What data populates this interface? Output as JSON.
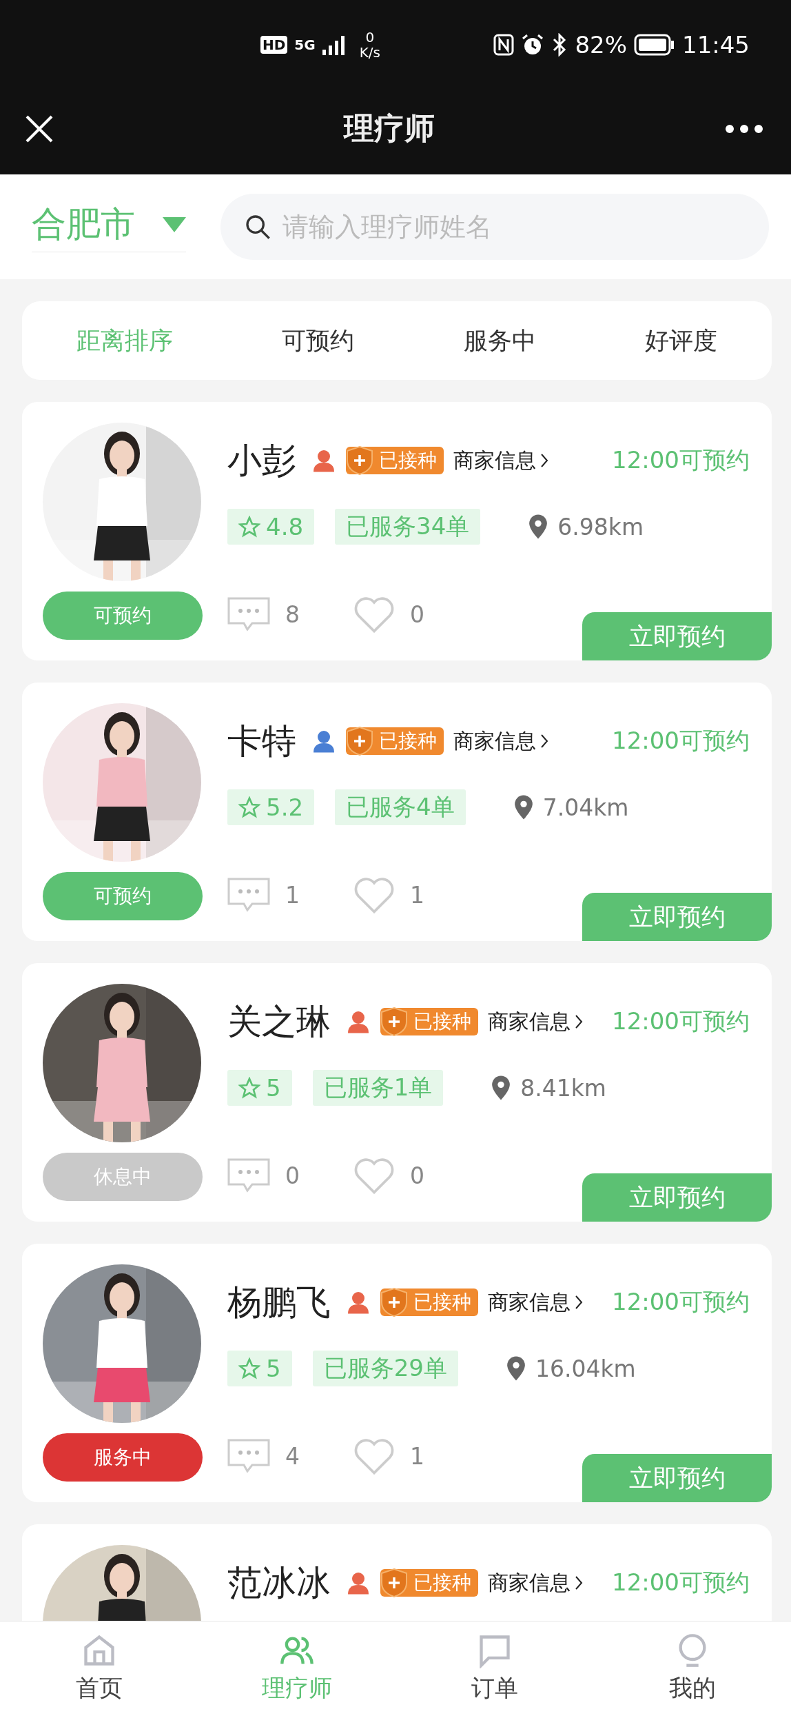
{
  "status_bar": {
    "hd": "HD",
    "network": "5G",
    "speed_value": "0",
    "speed_unit": "K/s",
    "battery": "82%",
    "time": "11:45"
  },
  "header": {
    "title": "理疗师"
  },
  "search": {
    "city": "合肥市",
    "placeholder": "请输入理疗师姓名"
  },
  "sort_tabs": [
    {
      "label": "距离排序",
      "selected": true
    },
    {
      "label": "可预约",
      "selected": false
    },
    {
      "label": "服务中",
      "selected": false
    },
    {
      "label": "好评度",
      "selected": false
    }
  ],
  "therapists": [
    {
      "name": "小彭",
      "color": "#e8654a",
      "badge": "已接种",
      "merchant": "商家信息",
      "availability": "12:00可预约",
      "status": {
        "label": "可预约",
        "color": "#5cc173"
      },
      "rating": "4.8",
      "served": "已服务34单",
      "distance": "6.98km",
      "comments": "8",
      "likes": "0",
      "book": "立即预约"
    },
    {
      "name": "卡特",
      "color": "#4a7fd4",
      "badge": "已接种",
      "merchant": "商家信息",
      "availability": "12:00可预约",
      "status": {
        "label": "可预约",
        "color": "#5cc173"
      },
      "rating": "5.2",
      "served": "已服务4单",
      "distance": "7.04km",
      "comments": "1",
      "likes": "1",
      "book": "立即预约"
    },
    {
      "name": "关之琳",
      "color": "#e8654a",
      "badge": "已接种",
      "merchant": "商家信息",
      "availability": "12:00可预约",
      "status": {
        "label": "休息中",
        "color": "#c9c9c9"
      },
      "rating": "5",
      "served": "已服务1单",
      "distance": "8.41km",
      "comments": "0",
      "likes": "0",
      "book": "立即预约"
    },
    {
      "name": "杨鹏飞",
      "color": "#e8654a",
      "badge": "已接种",
      "merchant": "商家信息",
      "availability": "12:00可预约",
      "status": {
        "label": "服务中",
        "color": "#dc3535"
      },
      "rating": "5",
      "served": "已服务29单",
      "distance": "16.04km",
      "comments": "4",
      "likes": "1",
      "book": "立即预约"
    },
    {
      "name": "范冰冰",
      "color": "#e8654a",
      "badge": "已接种",
      "merchant": "商家信息",
      "availability": "12:00可预约"
    }
  ],
  "bottom_nav": [
    {
      "label": "首页",
      "selected": false
    },
    {
      "label": "理疗师",
      "selected": true
    },
    {
      "label": "订单",
      "selected": false
    },
    {
      "label": "我的",
      "selected": false
    }
  ]
}
